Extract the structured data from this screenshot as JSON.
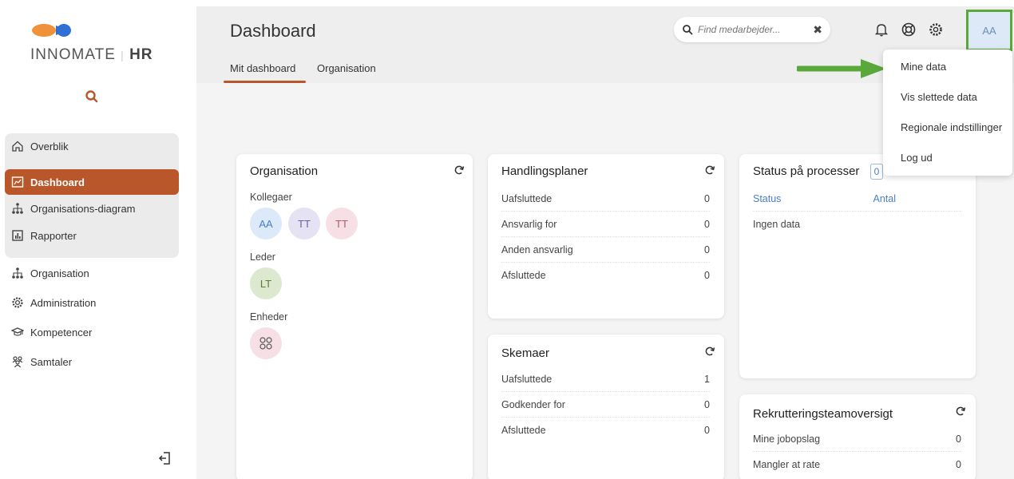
{
  "brand": {
    "name": "INNOMATE",
    "suffix": "HR",
    "colors": {
      "orange": "#f0923a",
      "blue": "#2f6fd6",
      "accent": "#b9572a",
      "highlight": "#5aa83a"
    }
  },
  "sidebar": {
    "group_items": [
      {
        "label": "Overblik",
        "icon": "home-icon"
      },
      {
        "label": "Dashboard",
        "icon": "dashboard-icon",
        "active": true
      },
      {
        "label": "Organisations-diagram",
        "icon": "org-chart-icon"
      },
      {
        "label": "Rapporter",
        "icon": "report-icon"
      }
    ],
    "items": [
      {
        "label": "Organisation",
        "icon": "org-chart-icon"
      },
      {
        "label": "Administration",
        "icon": "gear-icon"
      },
      {
        "label": "Kompetencer",
        "icon": "graduation-cap-icon"
      },
      {
        "label": "Samtaler",
        "icon": "people-icon"
      }
    ]
  },
  "header": {
    "title": "Dashboard",
    "tabs": [
      {
        "label": "Mit dashboard",
        "active": true
      },
      {
        "label": "Organisation"
      }
    ],
    "search_placeholder": "Find medarbejder...",
    "avatar": "AA"
  },
  "user_menu": {
    "items": [
      "Mine data",
      "Vis slettede data",
      "Regionale indstillinger",
      "Log ud"
    ]
  },
  "cards": {
    "organisation": {
      "title": "Organisation",
      "colleagues_label": "Kollegaer",
      "colleagues": [
        "AA",
        "TT",
        "TT"
      ],
      "leader_label": "Leder",
      "leader": "LT",
      "units_label": "Enheder"
    },
    "handlingsplaner": {
      "title": "Handlingsplaner",
      "rows": [
        {
          "label": "Uafsluttede",
          "value": "0"
        },
        {
          "label": "Ansvarlig for",
          "value": "0"
        },
        {
          "label": "Anden ansvarlig",
          "value": "0"
        },
        {
          "label": "Afsluttede",
          "value": "0"
        }
      ]
    },
    "status": {
      "title": "Status på processer",
      "badge": "0",
      "col_status": "Status",
      "col_count": "Antal",
      "empty": "Ingen data"
    },
    "skemaer": {
      "title": "Skemaer",
      "rows": [
        {
          "label": "Uafsluttede",
          "value": "1"
        },
        {
          "label": "Godkender for",
          "value": "0"
        },
        {
          "label": "Afsluttede",
          "value": "0"
        }
      ]
    },
    "rekruttering": {
      "title": "Rekrutteringsteamoversigt",
      "rows": [
        {
          "label": "Mine jobopslag",
          "value": "0"
        },
        {
          "label": "Mangler at rate",
          "value": "0"
        }
      ]
    }
  }
}
